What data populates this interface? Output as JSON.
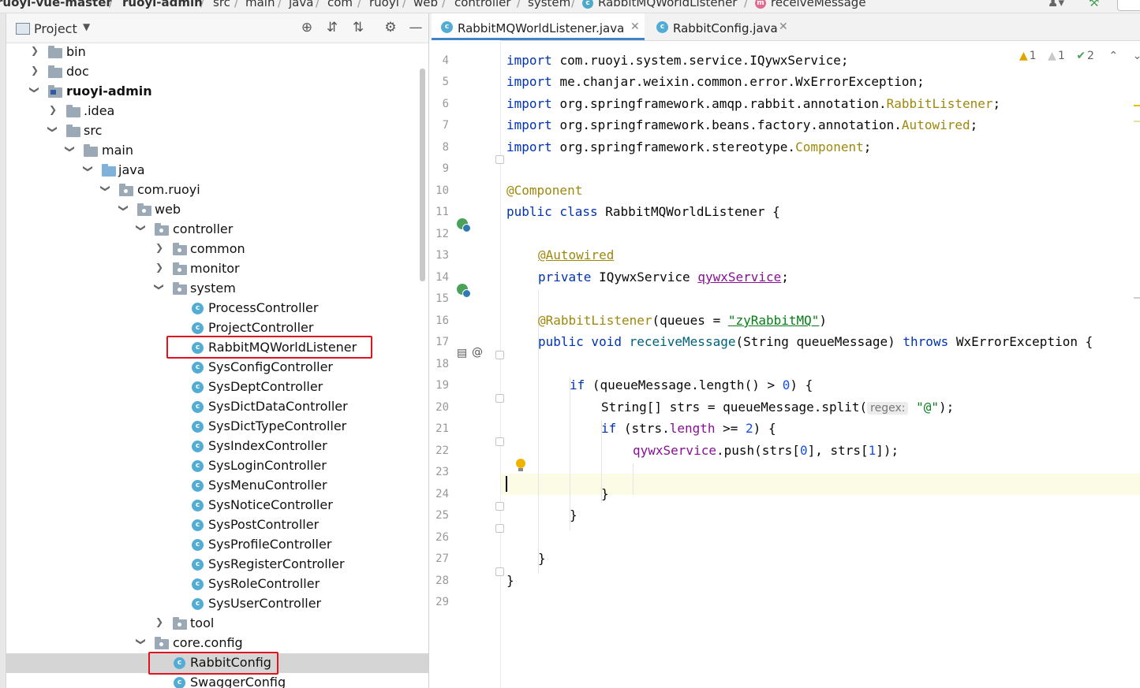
{
  "breadcrumb": {
    "items": [
      "ruoyi-vue-master",
      "ruoyi-admin",
      "src",
      "main",
      "java",
      "com",
      "ruoyi",
      "web",
      "controller",
      "system",
      "RabbitMQWorldListener",
      "receiveMessage"
    ]
  },
  "project_panel": {
    "title": "Project",
    "tree": [
      {
        "label": "bin"
      },
      {
        "label": "doc"
      },
      {
        "label": "ruoyi-admin"
      },
      {
        "label": ".idea"
      },
      {
        "label": "src"
      },
      {
        "label": "main"
      },
      {
        "label": "java"
      },
      {
        "label": "com.ruoyi"
      },
      {
        "label": "web"
      },
      {
        "label": "controller"
      },
      {
        "label": "common"
      },
      {
        "label": "monitor"
      },
      {
        "label": "system"
      },
      {
        "label": "ProcessController"
      },
      {
        "label": "ProjectController"
      },
      {
        "label": "RabbitMQWorldListener"
      },
      {
        "label": "SysConfigController"
      },
      {
        "label": "SysDeptController"
      },
      {
        "label": "SysDictDataController"
      },
      {
        "label": "SysDictTypeController"
      },
      {
        "label": "SysIndexController"
      },
      {
        "label": "SysLoginController"
      },
      {
        "label": "SysMenuController"
      },
      {
        "label": "SysNoticeController"
      },
      {
        "label": "SysPostController"
      },
      {
        "label": "SysProfileController"
      },
      {
        "label": "SysRegisterController"
      },
      {
        "label": "SysRoleController"
      },
      {
        "label": "SysUserController"
      },
      {
        "label": "tool"
      },
      {
        "label": "core.config"
      },
      {
        "label": "RabbitConfig"
      },
      {
        "label": "SwaggerConfig"
      }
    ]
  },
  "editor": {
    "tabs": [
      {
        "label": "RabbitMQWorldListener.java"
      },
      {
        "label": "RabbitConfig.java"
      }
    ],
    "inspections": {
      "warnings": "1",
      "weak_warnings": "1",
      "typos": "2"
    },
    "line_numbers": [
      "4",
      "5",
      "6",
      "7",
      "8",
      "9",
      "10",
      "11",
      "12",
      "13",
      "14",
      "15",
      "16",
      "17",
      "18",
      "19",
      "20",
      "21",
      "22",
      "23",
      "24",
      "25",
      "26",
      "27",
      "28",
      "29"
    ],
    "code": {
      "l4_kw": "import",
      "l4_rest": "com.ruoyi.system.service.IQywxService;",
      "l5_kw": "import",
      "l5_rest": "me.chanjar.weixin.common.error.WxErrorException;",
      "l6_kw": "import",
      "l6_pre": "org.springframework.amqp.rabbit.annotation.",
      "l6_ann": "RabbitListener",
      "l6_end": ";",
      "l7_kw": "import",
      "l7_pre": "org.springframework.beans.factory.annotation.",
      "l7_ann": "Autowired",
      "l7_end": ";",
      "l8_kw": "import",
      "l8_pre": "org.springframework.stereotype.",
      "l8_ann": "Component",
      "l8_end": ";",
      "l10_ann": "@Component",
      "l11_kw": "public class",
      "l11_rest": "RabbitMQWorldListener {",
      "l13_ann": "@Autowired",
      "l14_kw": "private",
      "l14_type": "IQywxService",
      "l14_fld": "qywxService",
      "l14_end": ";",
      "l16_ann": "@RabbitListener",
      "l16_a": "(queues = ",
      "l16_str": "\"zyRabbitMQ\"",
      "l16_b": ")",
      "l17_kw": "public void",
      "l17_meth": "receiveMessage",
      "l17_a": "(String queueMessage)",
      "l17_kw2": "throws",
      "l17_b": "WxErrorException {",
      "l19_kw": "if",
      "l19_a": "(queueMessage.length() > ",
      "l19_num": "0",
      "l19_b": ") {",
      "l20_a": "String[] strs = queueMessage.split(",
      "l20_hint": "regex:",
      "l20_str": "\"@\"",
      "l20_b": ");",
      "l21_kw": "if",
      "l21_a": "(strs.",
      "l21_fld": "length",
      "l21_b": " >= ",
      "l21_num": "2",
      "l21_c": ") {",
      "l22_fld": "qywxService",
      "l22_a": ".push(strs[",
      "l22_n1": "0",
      "l22_b": "], strs[",
      "l22_n2": "1",
      "l22_c": "]);",
      "l24": "}",
      "l25": "}",
      "l27": "}",
      "l28": "}"
    }
  },
  "colors": {
    "keyword": "#0033b3",
    "annotation": "#9e880d",
    "field": "#871094",
    "number": "#1750eb",
    "string": "#067d17",
    "highlight_box": "#e0141e"
  }
}
